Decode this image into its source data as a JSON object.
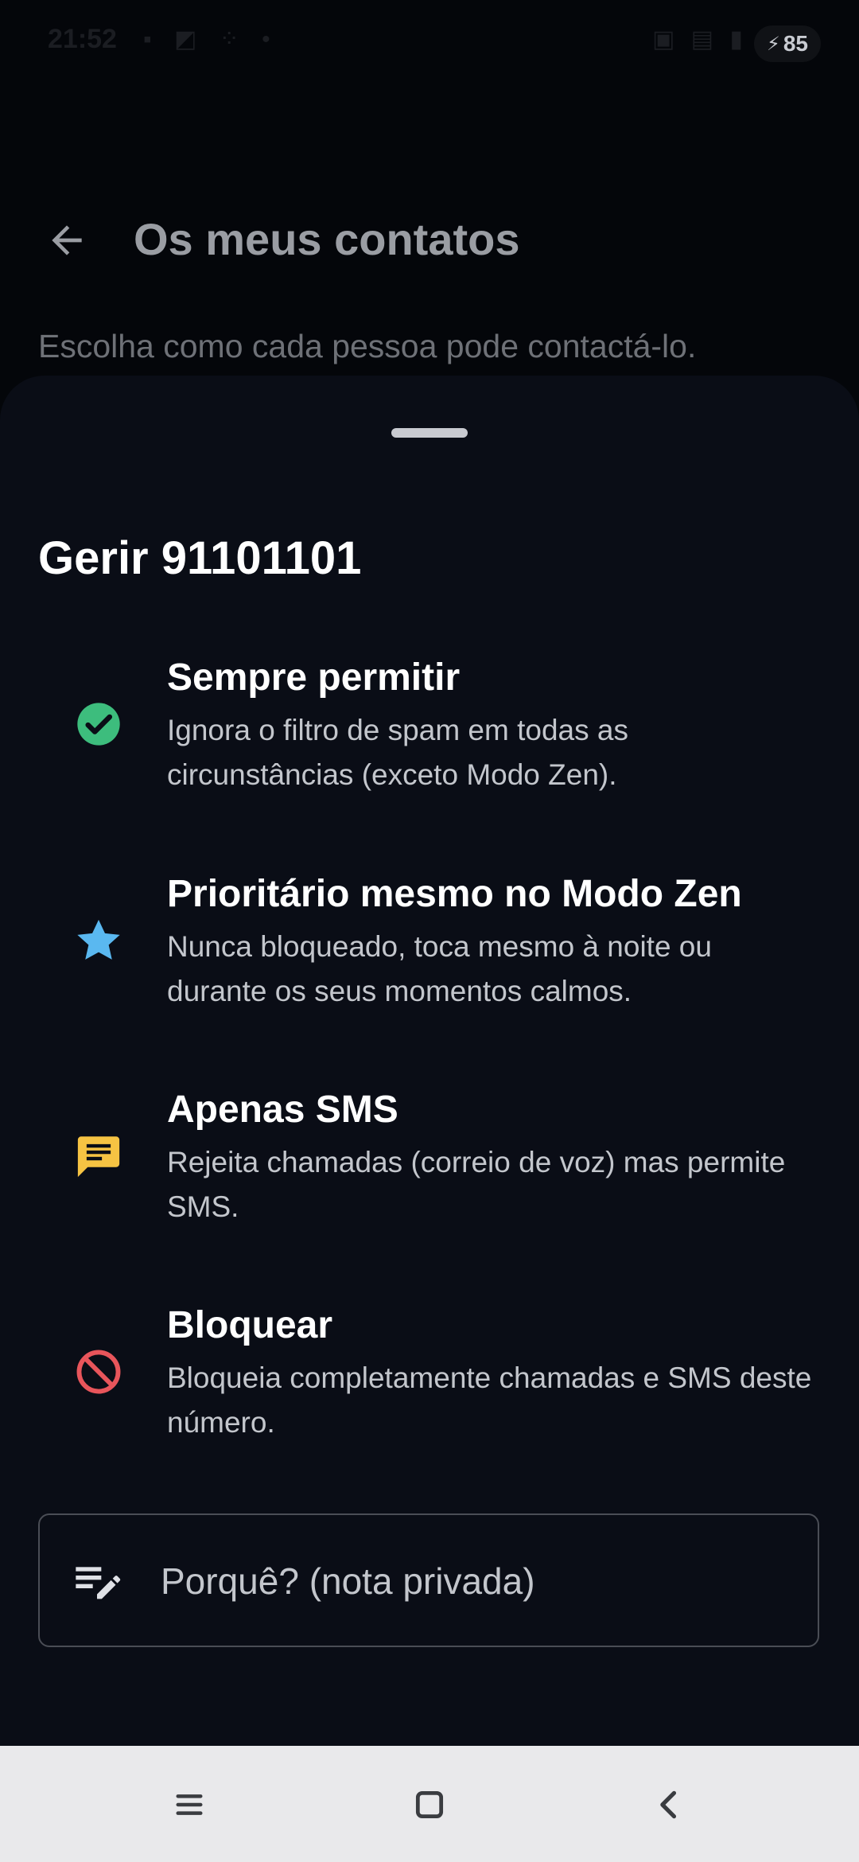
{
  "status_bar": {
    "time": "21:52",
    "left_icons": "▪ ◩ ⁘ •",
    "right_icons": "▣ ▤ ▮",
    "battery_level": "85"
  },
  "app_bar": {
    "title": "Os meus contatos",
    "back_icon": "arrow-back-icon"
  },
  "page": {
    "subtitle": "Escolha como cada pessoa pode contactá-lo."
  },
  "sheet": {
    "title": "Gerir 91101101",
    "options": [
      {
        "title": "Sempre permitir",
        "description": "Ignora o filtro de spam em todas as circunstâncias (exceto Modo Zen).",
        "icon": "check-circle-icon",
        "color": "#3dbd7d"
      },
      {
        "title": "Prioritário mesmo no Modo Zen",
        "description": "Nunca bloqueado, toca mesmo à noite ou durante os seus momentos calmos.",
        "icon": "star-icon",
        "color": "#5ab8f0"
      },
      {
        "title": "Apenas SMS",
        "description": "Rejeita chamadas (correio de voz) mas permite SMS.",
        "icon": "message-icon",
        "color": "#f6c343"
      },
      {
        "title": "Bloquear",
        "description": "Bloqueia completamente chamadas e SMS deste número.",
        "icon": "block-icon",
        "color": "#e8555b"
      }
    ],
    "note": {
      "placeholder": "Porquê? (nota privada)",
      "value": ""
    }
  },
  "nav_bar": {
    "menu_icon": "menu-icon",
    "home_icon": "home-square-icon",
    "back_icon": "back-chevron-icon"
  }
}
